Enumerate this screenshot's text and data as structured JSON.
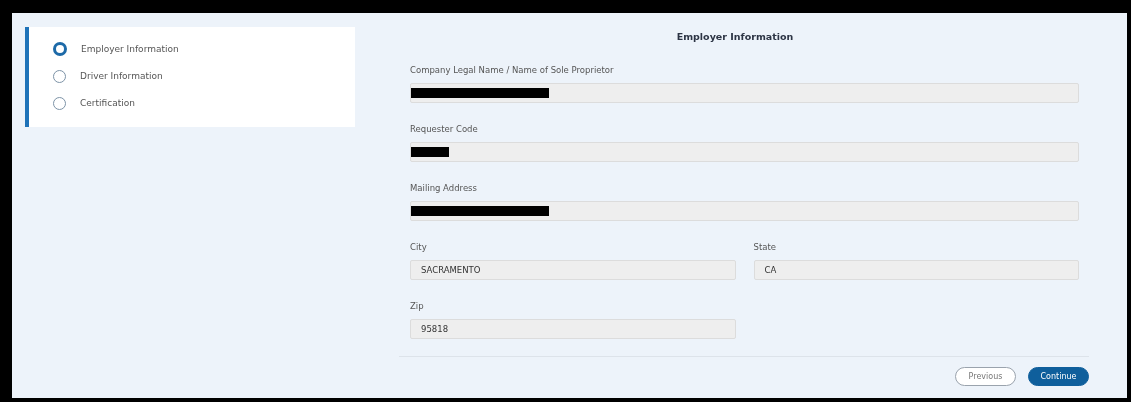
{
  "steps": [
    {
      "label": "Employer Information",
      "selected": true
    },
    {
      "label": "Driver Information",
      "selected": false
    },
    {
      "label": "Certification",
      "selected": false
    }
  ],
  "form": {
    "title": "Employer Information",
    "rows": [
      [
        {
          "label": "Company Legal Name / Name of Sole Proprietor",
          "redacted": true
        }
      ],
      [
        {
          "label": "Requester Code",
          "redacted": true
        }
      ],
      [
        {
          "label": "Mailing Address",
          "redacted": true
        }
      ],
      [
        {
          "label": "City",
          "value": "SACRAMENTO",
          "redacted": false
        },
        {
          "label": "State",
          "value": "CA",
          "redacted": false
        }
      ],
      [
        {
          "label": "Zip",
          "value": "95818",
          "redacted": false
        },
        {
          "kind": "empty"
        }
      ]
    ]
  },
  "buttons": [
    {
      "label": "Previous",
      "kind": "secondary"
    },
    {
      "label": "Continue",
      "kind": "primary"
    }
  ]
}
